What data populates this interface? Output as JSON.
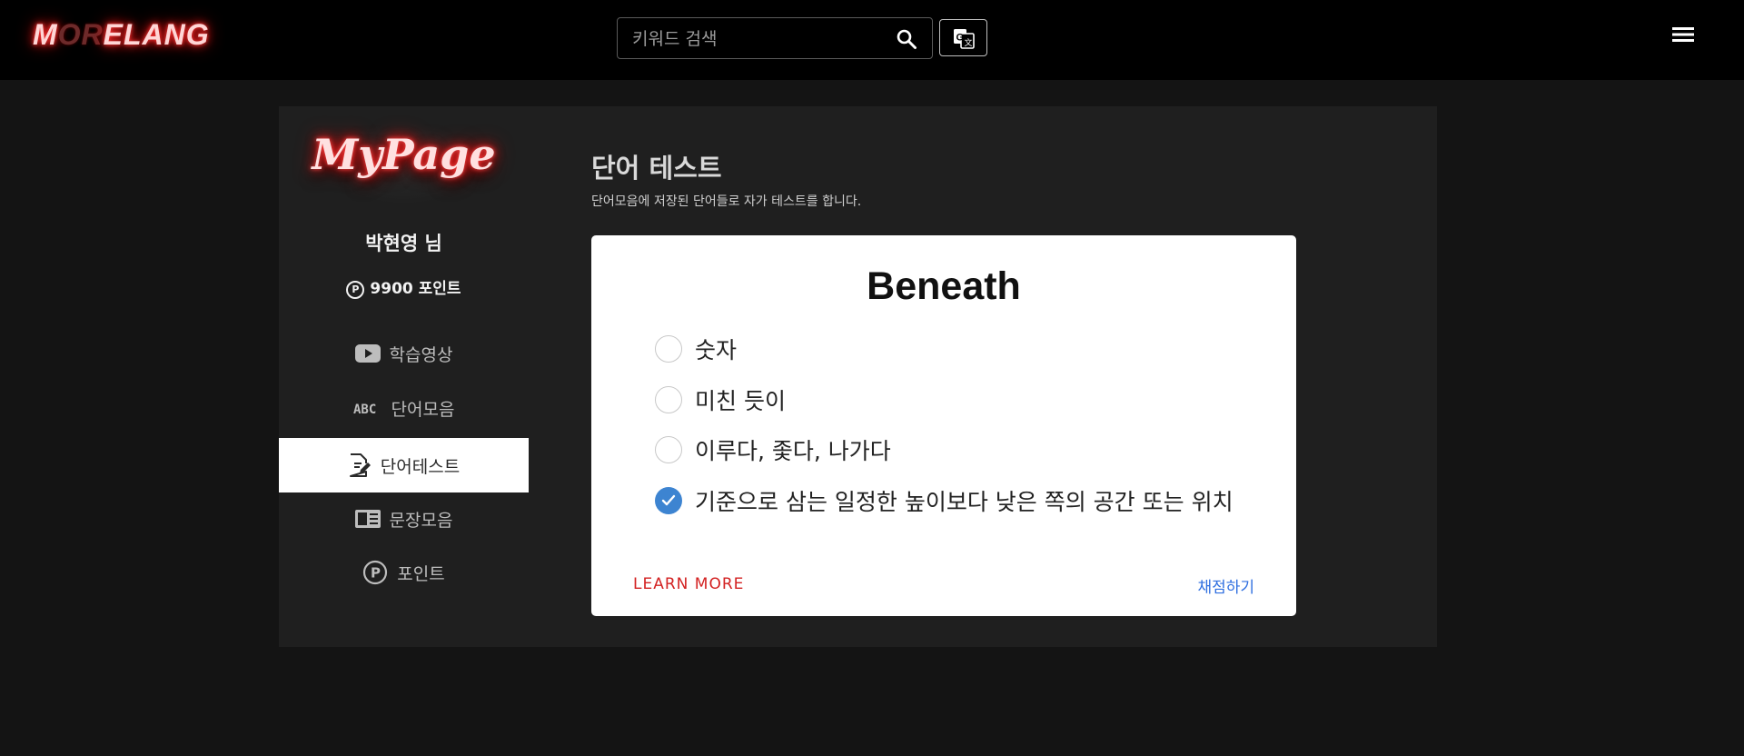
{
  "header": {
    "logo": {
      "part1": "M",
      "part2": "OR",
      "part3": "ELANG"
    },
    "search": {
      "placeholder": "키워드 검색",
      "value": ""
    },
    "icons": [
      "search-icon",
      "translate-icon",
      "hamburger-menu-icon"
    ]
  },
  "sidebar": {
    "heading": "MyPage",
    "username": "박현영 님",
    "points_badge": "P",
    "points": "9900 포인트",
    "items": [
      {
        "label": "학습영상",
        "icon": "youtube-icon",
        "active": false
      },
      {
        "label": "단어모음",
        "icon": "abc-icon",
        "active": false
      },
      {
        "label": "단어테스트",
        "icon": "document-edit-icon",
        "active": true
      },
      {
        "label": "문장모음",
        "icon": "article-icon",
        "active": false
      },
      {
        "label": "포인트",
        "icon": "points-icon",
        "active": false
      }
    ]
  },
  "main": {
    "title": "단어 테스트",
    "subtitle": "단어모음에 저장된 단어들로 자가 테스트를 합니다.",
    "quiz": {
      "word": "Beneath",
      "options": [
        {
          "label": "숫자",
          "checked": false
        },
        {
          "label": "미친 듯이",
          "checked": false
        },
        {
          "label": "이루다, 좇다, 나가다",
          "checked": false
        },
        {
          "label": "기준으로 삼는 일정한 높이보다 낮은 쪽의 공간 또는 위치",
          "checked": true
        }
      ],
      "learn_more": "LEARN MORE",
      "grade": "채점하기"
    }
  },
  "colors": {
    "page_bg": "#141414",
    "topbar_bg": "#000000",
    "panel_bg": "#1f1f1f",
    "neon_red": "#ff1a1a",
    "radio_checked": "#3d84d1",
    "learn_more": "#d32222",
    "grade_link": "#2f6fe0"
  }
}
